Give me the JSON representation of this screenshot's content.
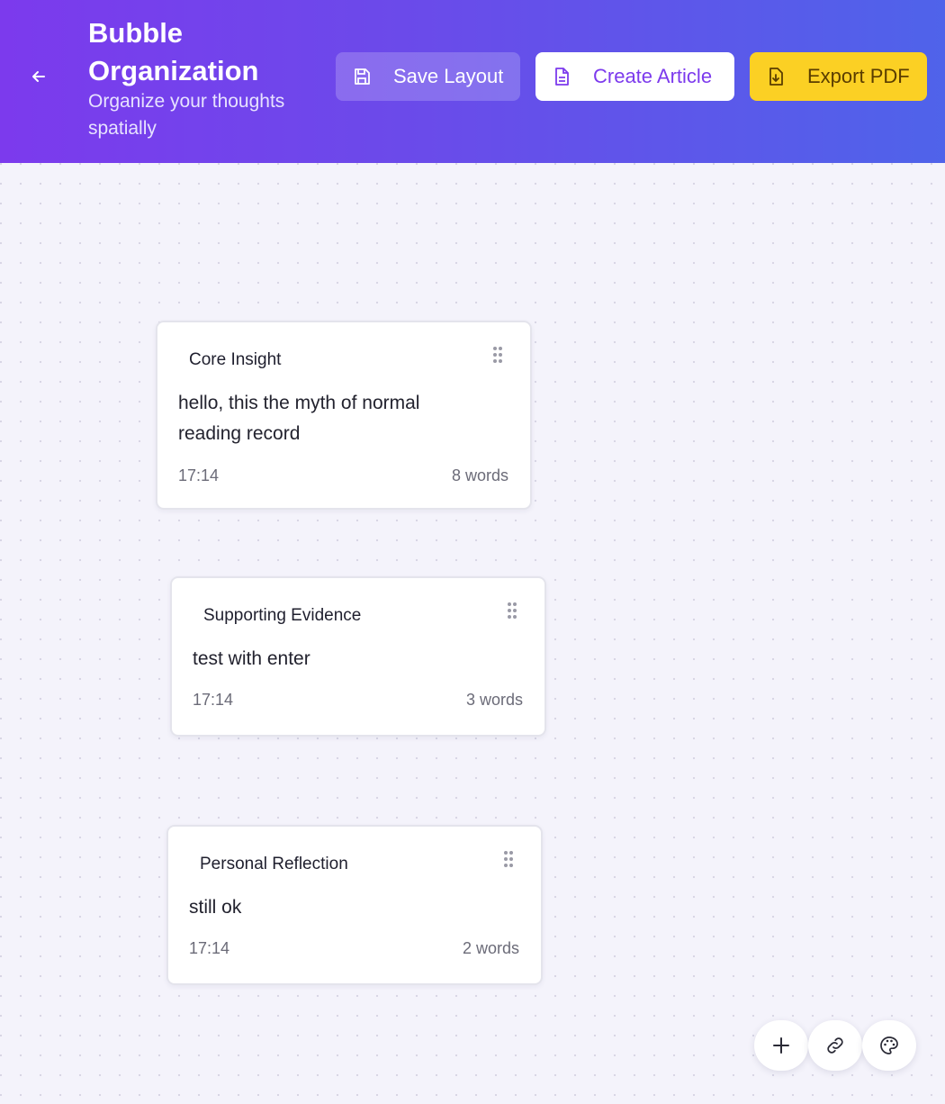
{
  "header": {
    "title": "Bubble Organization",
    "subtitle": "Organize your thoughts spatially",
    "back_icon": "arrow-left-icon",
    "buttons": {
      "save": {
        "label": "Save Layout",
        "icon": "save-icon"
      },
      "create": {
        "label": "Create Article",
        "icon": "document-icon"
      },
      "export": {
        "label": "Export PDF",
        "icon": "download-file-icon"
      }
    }
  },
  "colors": {
    "header_gradient_start": "#7c3aed",
    "header_gradient_end": "#4f63ea",
    "export_button": "#fbd024",
    "create_text": "#7c3aed"
  },
  "cards": [
    {
      "label": "Core Insight",
      "content": "hello, this the myth of normal reading record",
      "time": "17:14",
      "words": "8 words"
    },
    {
      "label": "Supporting Evidence",
      "content": "test with enter",
      "time": "17:14",
      "words": "3 words"
    },
    {
      "label": "Personal Reflection",
      "content": "still ok",
      "time": "17:14",
      "words": "2 words"
    }
  ],
  "fabs": {
    "add": "plus-icon",
    "link": "link-icon",
    "palette": "palette-icon"
  }
}
